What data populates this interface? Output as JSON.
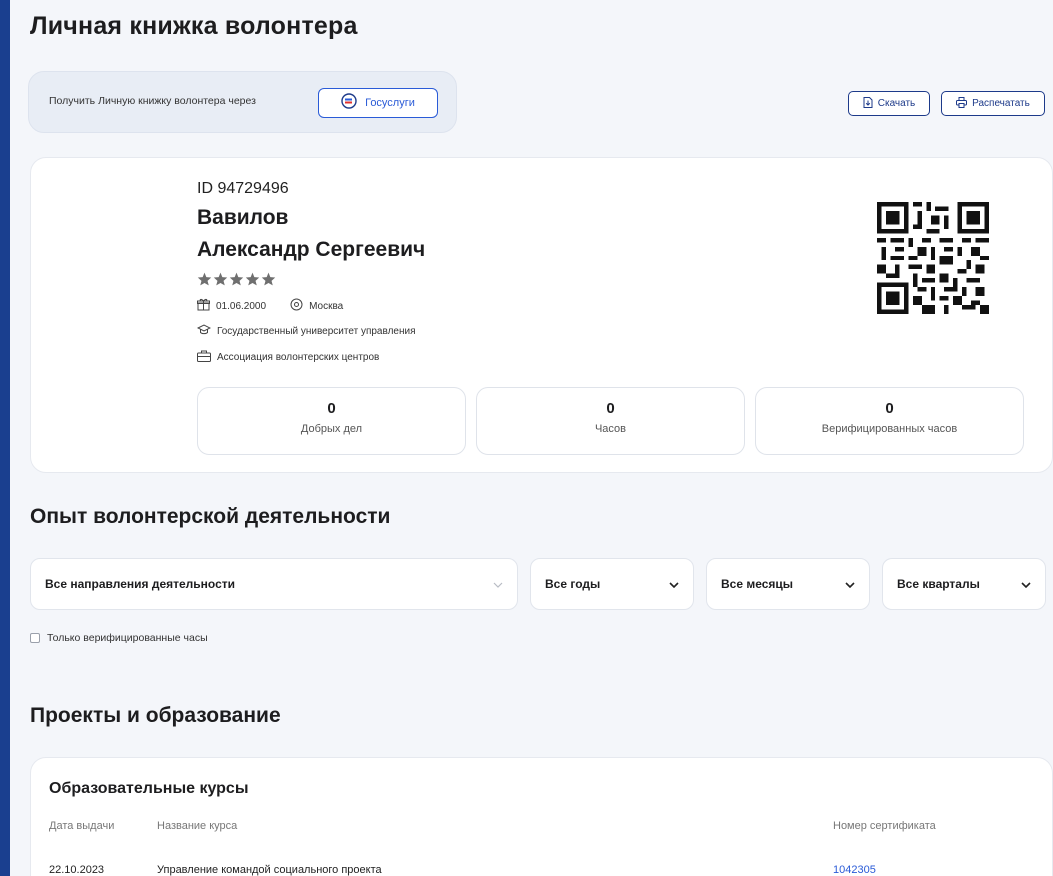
{
  "page_title": "Личная книжка волонтера",
  "gosuslugi": {
    "prompt": "Получить Личную книжку волонтера через",
    "button_label": "Госуслуги"
  },
  "actions": {
    "download_label": "Скачать",
    "print_label": "Распечатать"
  },
  "profile": {
    "id": "ID 94729496",
    "last_name": "Вавилов",
    "first_middle_name": "Александр Сергеевич",
    "rating_stars": 5,
    "birth_date": "01.06.2000",
    "city": "Москва",
    "university": "Государственный университет управления",
    "organization": "Ассоциация волонтерских центров"
  },
  "stats": [
    {
      "value": "0",
      "label": "Добрых дел"
    },
    {
      "value": "0",
      "label": "Часов"
    },
    {
      "value": "0",
      "label": "Верифицированных часов"
    }
  ],
  "experience": {
    "title": "Опыт волонтерской деятельности",
    "filters": {
      "direction": "Все направления деятельности",
      "years": "Все годы",
      "months": "Все месяцы",
      "quarters": "Все кварталы"
    },
    "verified_only_label": "Только верифицированные часы",
    "verified_only_checked": false
  },
  "projects": {
    "title": "Проекты и образование",
    "courses": {
      "title": "Образовательные курсы",
      "columns": [
        "Дата выдачи",
        "Название курса",
        "Номер сертификата"
      ],
      "rows": [
        {
          "date": "22.10.2023",
          "name": "Управление командой социального проекта",
          "certificate": "1042305"
        }
      ]
    }
  },
  "colors": {
    "frame": "#1a3f8f",
    "accent": "#2a5bd7",
    "background": "#f4f6fa"
  }
}
